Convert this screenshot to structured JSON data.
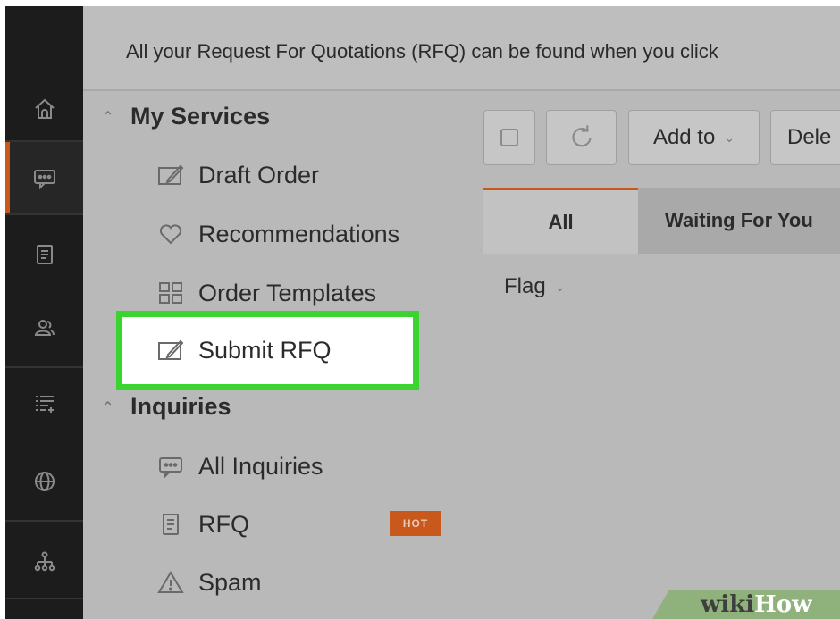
{
  "banner": {
    "text": "All your Request For Quotations (RFQ) can be found when you click"
  },
  "rail": {
    "items": [
      {
        "icon": "home-icon"
      },
      {
        "icon": "message-icon"
      },
      {
        "icon": "document-icon"
      },
      {
        "icon": "users-icon"
      },
      {
        "icon": "list-add-icon"
      },
      {
        "icon": "globe-icon"
      },
      {
        "icon": "org-chart-icon"
      }
    ]
  },
  "sidebar": {
    "my_services": {
      "title": "My Services",
      "items": [
        {
          "label": "Draft Order",
          "icon": "edit-icon"
        },
        {
          "label": "Recommendations",
          "icon": "heart-icon"
        },
        {
          "label": "Order Templates",
          "icon": "grid-icon"
        },
        {
          "label": "Submit RFQ",
          "icon": "edit-icon"
        }
      ]
    },
    "inquiries": {
      "title": "Inquiries",
      "items": [
        {
          "label": "All Inquiries",
          "icon": "message-icon"
        },
        {
          "label": "RFQ",
          "icon": "document-icon",
          "badge": "HOT"
        },
        {
          "label": "Spam",
          "icon": "warning-icon"
        }
      ]
    }
  },
  "toolbar": {
    "add_to": "Add to",
    "delete": "Dele"
  },
  "tabs": [
    {
      "label": "All",
      "active": true
    },
    {
      "label": "Waiting For You",
      "active": false
    }
  ],
  "filter": {
    "flag": "Flag"
  },
  "watermark": {
    "part1": "wiki",
    "part2": "How"
  },
  "colors": {
    "accent": "#c8581c",
    "highlight": "#3bd42f",
    "rail": "#1c1c1c",
    "background": "#b9b9b9"
  }
}
